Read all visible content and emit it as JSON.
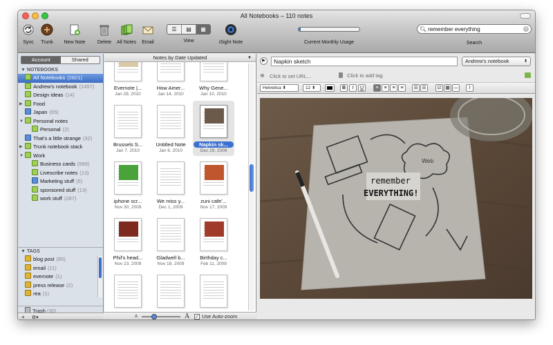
{
  "window": {
    "title": "All Notebooks – 110 notes"
  },
  "toolbar": {
    "sync": "Sync",
    "trunk": "Trunk",
    "new_note": "New Note",
    "delete": "Delete",
    "all_notes": "All Notes",
    "email": "Email",
    "view": "View",
    "isight": "iSight Note",
    "usage_label": "Current Monthly Usage",
    "usage_fraction": 0.03,
    "search_label": "Search",
    "search_value": "remember everything"
  },
  "sidebar": {
    "tab_account": "Account",
    "tab_shared": "Shared",
    "notebooks_header": "NOTEBOOKS",
    "notebooks": [
      {
        "label": "All Notebooks",
        "count": "(2821)"
      },
      {
        "label": "Andrew's notebook",
        "count": "(1457)"
      },
      {
        "label": "Design ideas",
        "count": "(14)"
      },
      {
        "label": "Food",
        "count": ""
      },
      {
        "label": "Japan",
        "count": "(65)"
      },
      {
        "label": "Personal notes",
        "count": ""
      },
      {
        "label": "Personal",
        "count": "(2)"
      },
      {
        "label": "That's a little strange",
        "count": "(32)"
      },
      {
        "label": "Trunk notebook stack",
        "count": ""
      },
      {
        "label": "Work",
        "count": ""
      },
      {
        "label": "Business cards",
        "count": "(589)"
      },
      {
        "label": "Livescribe notes",
        "count": "(13)"
      },
      {
        "label": "Marketing stuff",
        "count": "(5)"
      },
      {
        "label": "sponsored stuff",
        "count": "(13)"
      },
      {
        "label": "work stuff",
        "count": "(287)"
      }
    ],
    "tags_header": "TAGS",
    "tags": [
      {
        "label": "blog post",
        "count": "(85)"
      },
      {
        "label": "email",
        "count": "(11)"
      },
      {
        "label": "evernote",
        "count": "(1)"
      },
      {
        "label": "press release",
        "count": "(2)"
      },
      {
        "label": "rea",
        "count": "(1)"
      }
    ],
    "trash": {
      "label": "Trash",
      "count": "(30)"
    },
    "add": "+",
    "gear": "⚙▾"
  },
  "notes": {
    "sort_label": "Notes by Date Updated",
    "items": [
      {
        "title": "Evernote |...",
        "date": "Jan 29, 2010"
      },
      {
        "title": "How Amer...",
        "date": "Jan 14, 2010"
      },
      {
        "title": "Why Gene...",
        "date": "Jan 10, 2010"
      },
      {
        "title": "Brussels S...",
        "date": "Jan 7, 2010"
      },
      {
        "title": "Untitled Note",
        "date": "Jan 6, 2010"
      },
      {
        "title": "Napkin sk...",
        "date": "Dec 29, 2009"
      },
      {
        "title": "iphone scr...",
        "date": "Nov 30, 2009"
      },
      {
        "title": "We miss y...",
        "date": "Dec 1, 2009"
      },
      {
        "title": "zuni cafe'...",
        "date": "Nov 17, 2009"
      },
      {
        "title": "Phil's head...",
        "date": "Nov 23, 2009"
      },
      {
        "title": "Gladwell b...",
        "date": "Nov 18, 2009"
      },
      {
        "title": "Birthday c...",
        "date": "Feb 11, 2009"
      }
    ],
    "zoom_small": "A",
    "zoom_large": "A",
    "auto_zoom": "Use Auto-zoom"
  },
  "note": {
    "title": "Napkin sketch",
    "notebook": "Andrew's notebook",
    "url_placeholder": "Click to set URL...",
    "tag_placeholder": "Click to add tag",
    "font": "Helvetica",
    "size": "12",
    "bold": "B",
    "italic": "I",
    "underline": "U",
    "sketch_line1": "remember",
    "sketch_line2": "EVERYTHING!",
    "sketch_web": "Web"
  },
  "colors": {
    "accent": "#3b6fd0",
    "selection": "#5b8be0"
  }
}
